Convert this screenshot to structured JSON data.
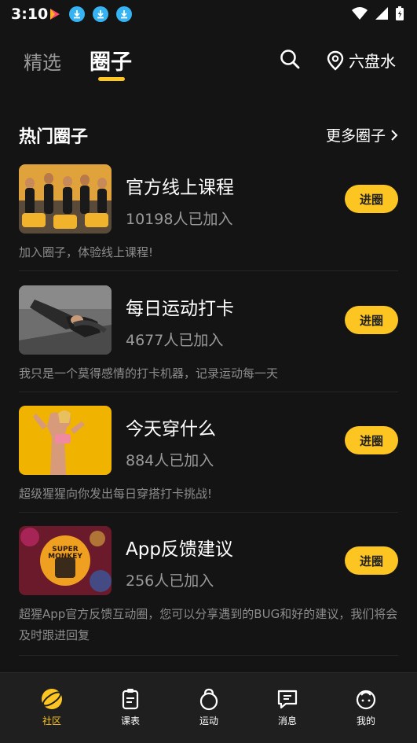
{
  "status": {
    "time": "3:10"
  },
  "nav": {
    "tab1": "精选",
    "tab2": "圈子",
    "location": "六盘水"
  },
  "section": {
    "title": "热门圈子",
    "more": "更多圈子"
  },
  "items": [
    {
      "name": "官方线上课程",
      "count": "10198人已加入",
      "desc": "加入圈子，体验线上课程!",
      "btn": "进圈"
    },
    {
      "name": "每日运动打卡",
      "count": "4677人已加入",
      "desc": "我只是一个莫得感情的打卡机器，记录运动每一天",
      "btn": "进圈"
    },
    {
      "name": "今天穿什么",
      "count": "884人已加入",
      "desc": "超级猩猩向你发出每日穿搭打卡挑战!",
      "btn": "进圈"
    },
    {
      "name": "App反馈建议",
      "count": "256人已加入",
      "desc": "超猩App官方反馈互动圈，您可以分享遇到的BUG和好的建议，我们将会及时跟进回复",
      "btn": "进圈"
    }
  ],
  "thumb4": {
    "line1": "SUPER",
    "line2": "MONKEY"
  },
  "bottom": {
    "tab1": "社区",
    "tab2": "课表",
    "tab3": "运动",
    "tab4": "消息",
    "tab5": "我的"
  },
  "colors": {
    "accent": "#fdc521",
    "background": "#141414"
  }
}
